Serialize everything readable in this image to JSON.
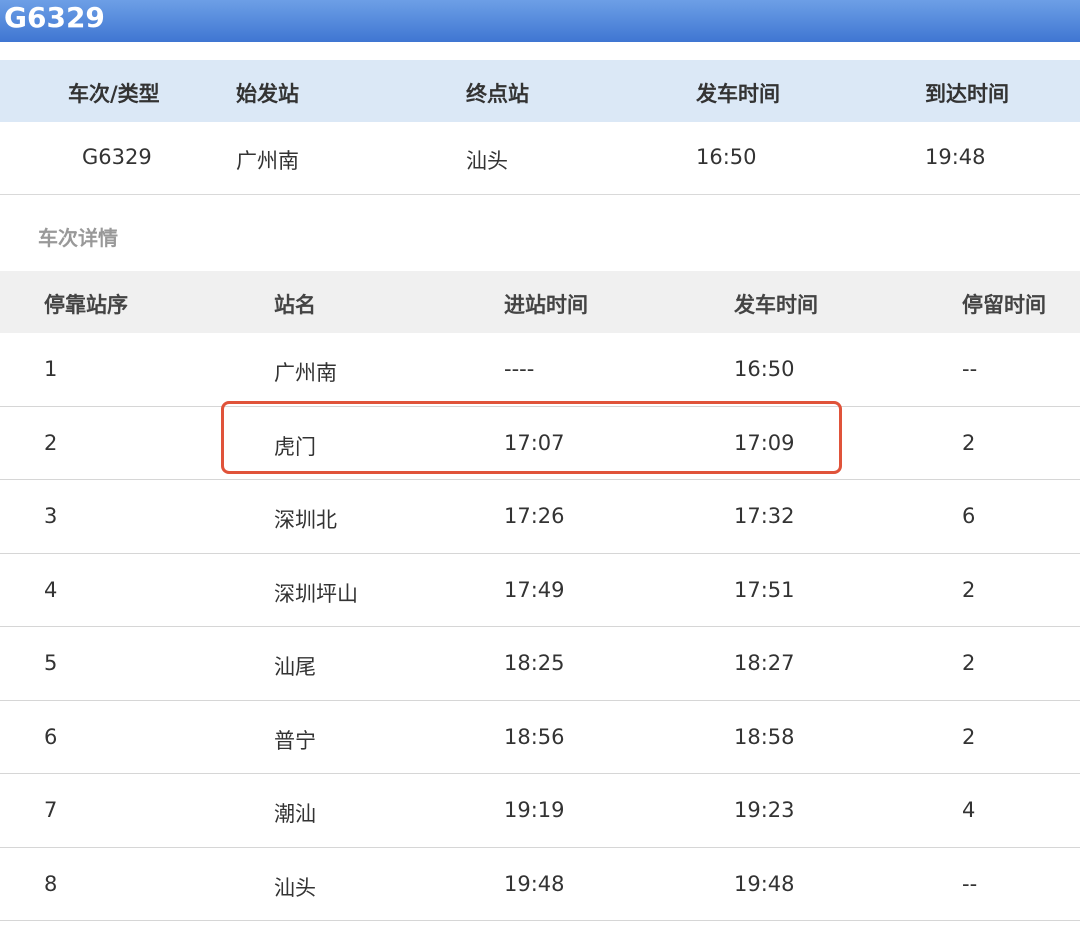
{
  "title": "G6329",
  "summary": {
    "headers": [
      "车次/类型",
      "始发站",
      "终点站",
      "发车时间",
      "到达时间"
    ],
    "values": [
      "G6329",
      "广州南",
      "汕头",
      "16:50",
      "19:48"
    ]
  },
  "section_label": "车次详情",
  "details": {
    "headers": [
      "停靠站序",
      "站名",
      "进站时间",
      "发车时间",
      "停留时间"
    ],
    "rows": [
      [
        "1",
        "广州南",
        "----",
        "16:50",
        "--"
      ],
      [
        "2",
        "虎门",
        "17:07",
        "17:09",
        "2"
      ],
      [
        "3",
        "深圳北",
        "17:26",
        "17:32",
        "6"
      ],
      [
        "4",
        "深圳坪山",
        "17:49",
        "17:51",
        "2"
      ],
      [
        "5",
        "汕尾",
        "18:25",
        "18:27",
        "2"
      ],
      [
        "6",
        "普宁",
        "18:56",
        "18:58",
        "2"
      ],
      [
        "7",
        "潮汕",
        "19:19",
        "19:23",
        "4"
      ],
      [
        "8",
        "汕头",
        "19:48",
        "19:48",
        "--"
      ]
    ]
  },
  "colors": {
    "title_bar": "#4a80d8",
    "summary_header_bg": "#dbe8f6",
    "detail_header_bg": "#f0f0f0",
    "highlight": "#e0533a"
  }
}
